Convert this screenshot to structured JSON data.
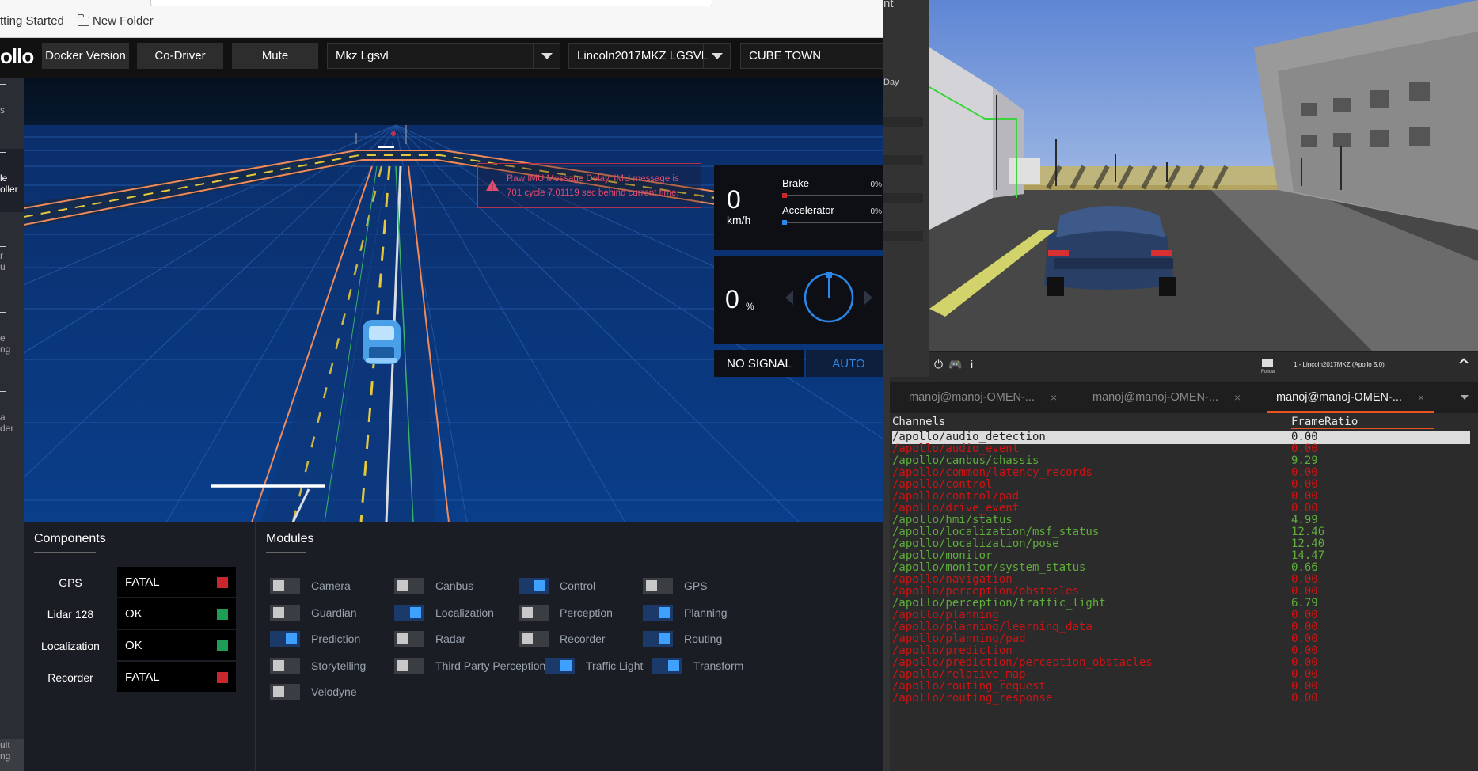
{
  "bookmarks": [
    {
      "label": "tting Started"
    },
    {
      "label": "New Folder"
    }
  ],
  "dreamview": {
    "logo": "ollo",
    "buttons": {
      "docker": "Docker Version",
      "codriver": "Co-Driver",
      "mute": "Mute"
    },
    "selects": {
      "mode": "Mkz Lgsvl",
      "vehicle": "Lincoln2017MKZ LGSVL",
      "map": "CUBE TOWN"
    },
    "side_nav": [
      {
        "label": "s"
      },
      {
        "label": "le\noller"
      },
      {
        "label": "r\nu"
      },
      {
        "label": "e\nng"
      },
      {
        "label": "a\nder"
      },
      {
        "label": "ult\nng"
      }
    ],
    "alert": {
      "text": "Raw IMU Message Delay. IMU message is 701 cycle 7.01119 sec behind current time."
    },
    "speed": {
      "value": "0",
      "unit": "km/h"
    },
    "brake": {
      "label": "Brake",
      "pct": "0%"
    },
    "accel": {
      "label": "Accelerator",
      "pct": "0%"
    },
    "steering": {
      "value": "0",
      "unit": "%"
    },
    "signal": {
      "status": "NO SIGNAL",
      "mode": "AUTO"
    },
    "components": {
      "title": "Components",
      "items": [
        {
          "name": "GPS",
          "status": "FATAL",
          "color": "#c8282d"
        },
        {
          "name": "Lidar 128",
          "status": "OK",
          "color": "#1f9d57"
        },
        {
          "name": "Localization",
          "status": "OK",
          "color": "#1f9d57"
        },
        {
          "name": "Recorder",
          "status": "FATAL",
          "color": "#c8282d"
        }
      ]
    },
    "modules": {
      "title": "Modules",
      "items": [
        {
          "label": "Camera",
          "on": false
        },
        {
          "label": "Canbus",
          "on": false
        },
        {
          "label": "Control",
          "on": true
        },
        {
          "label": "GPS",
          "on": false
        },
        {
          "label": "Guardian",
          "on": false
        },
        {
          "label": "Localization",
          "on": true
        },
        {
          "label": "Perception",
          "on": false
        },
        {
          "label": "Planning",
          "on": true
        },
        {
          "label": "Prediction",
          "on": true
        },
        {
          "label": "Radar",
          "on": false
        },
        {
          "label": "Recorder",
          "on": false
        },
        {
          "label": "Routing",
          "on": true
        },
        {
          "label": "Storytelling",
          "on": false
        },
        {
          "label": "Third Party Perception",
          "on": false
        },
        {
          "label": "Traffic Light",
          "on": true
        },
        {
          "label": "Transform",
          "on": true
        },
        {
          "label": "Velodyne",
          "on": false
        }
      ]
    }
  },
  "separator": {
    "frag_top": "nt",
    "frag_day": "Day"
  },
  "lgsvl": {
    "follow_label": "Follow",
    "vehicle_label": "1 - Lincoln2017MKZ (Apollo 5.0)",
    "icons": [
      "plug-icon",
      "gamepad-icon",
      "info-icon",
      "camera-icon"
    ]
  },
  "terminal": {
    "tabs": [
      {
        "label": "manoj@manoj-OMEN-...",
        "active": false
      },
      {
        "label": "manoj@manoj-OMEN-...",
        "active": false
      },
      {
        "label": "manoj@manoj-OMEN-...",
        "active": true
      }
    ],
    "headers": {
      "channels": "Channels",
      "frame_ratio": "FrameRatio"
    },
    "rows": [
      {
        "channel": "/apollo/audio_detection",
        "ratio": "0.00",
        "ok": null
      },
      {
        "channel": "/apollo/audio_event",
        "ratio": "0.00",
        "ok": false
      },
      {
        "channel": "/apollo/canbus/chassis",
        "ratio": "9.29",
        "ok": true
      },
      {
        "channel": "/apollo/common/latency_records",
        "ratio": "0.00",
        "ok": false
      },
      {
        "channel": "/apollo/control",
        "ratio": "0.00",
        "ok": false
      },
      {
        "channel": "/apollo/control/pad",
        "ratio": "0.00",
        "ok": false
      },
      {
        "channel": "/apollo/drive_event",
        "ratio": "0.00",
        "ok": false
      },
      {
        "channel": "/apollo/hmi/status",
        "ratio": "4.99",
        "ok": true
      },
      {
        "channel": "/apollo/localization/msf_status",
        "ratio": "12.46",
        "ok": true
      },
      {
        "channel": "/apollo/localization/pose",
        "ratio": "12.40",
        "ok": true
      },
      {
        "channel": "/apollo/monitor",
        "ratio": "14.47",
        "ok": true
      },
      {
        "channel": "/apollo/monitor/system_status",
        "ratio": "0.66",
        "ok": true
      },
      {
        "channel": "/apollo/navigation",
        "ratio": "0.00",
        "ok": false
      },
      {
        "channel": "/apollo/perception/obstacles",
        "ratio": "0.00",
        "ok": false
      },
      {
        "channel": "/apollo/perception/traffic_light",
        "ratio": "6.79",
        "ok": true
      },
      {
        "channel": "/apollo/planning",
        "ratio": "0.00",
        "ok": false
      },
      {
        "channel": "/apollo/planning/learning_data",
        "ratio": "0.00",
        "ok": false
      },
      {
        "channel": "/apollo/planning/pad",
        "ratio": "0.00",
        "ok": false
      },
      {
        "channel": "/apollo/prediction",
        "ratio": "0.00",
        "ok": false
      },
      {
        "channel": "/apollo/prediction/perception_obstacles",
        "ratio": "0.00",
        "ok": false
      },
      {
        "channel": "/apollo/relative_map",
        "ratio": "0.00",
        "ok": false
      },
      {
        "channel": "/apollo/routing_request",
        "ratio": "0.00",
        "ok": false
      },
      {
        "channel": "/apollo/routing_response",
        "ratio": "0.00",
        "ok": false
      }
    ]
  }
}
